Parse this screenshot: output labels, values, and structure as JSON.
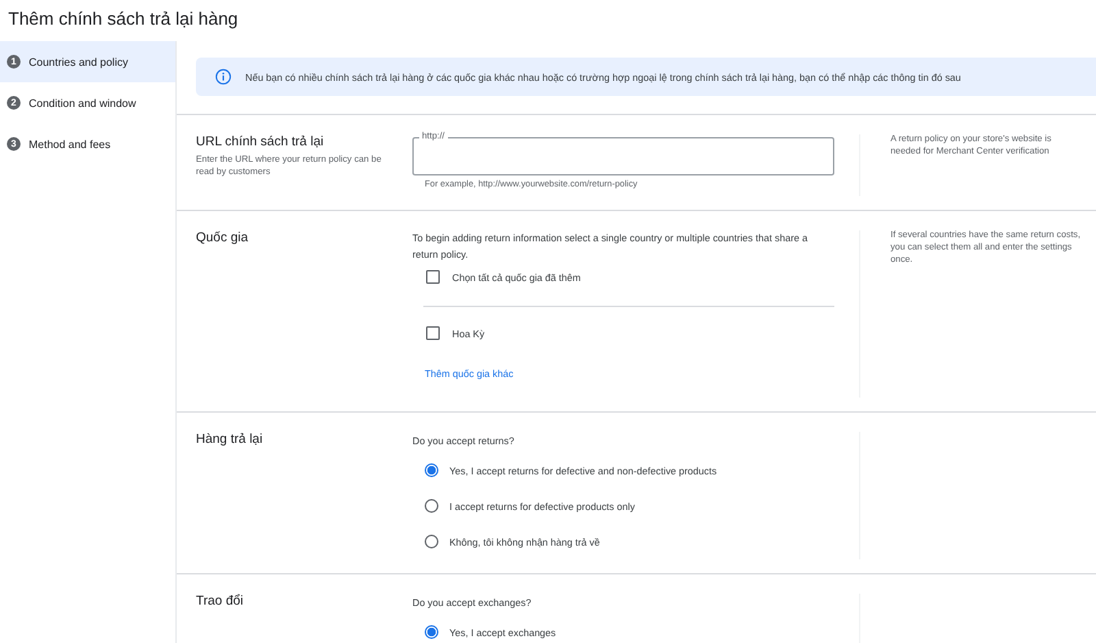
{
  "page_title": "Thêm chính sách trả lại hàng",
  "steps": [
    {
      "number": "1",
      "label": "Countries and policy",
      "selected": true
    },
    {
      "number": "2",
      "label": "Condition and window",
      "selected": false
    },
    {
      "number": "3",
      "label": "Method and fees",
      "selected": false
    }
  ],
  "info_banner": {
    "text": "Nếu bạn có nhiều chính sách trả lại hàng ở các quốc gia khác nhau hoặc có trường hợp ngoại lệ trong chính sách trả lại hàng, bạn có thể nhập các thông tin đó sau"
  },
  "sections": [
    {
      "kind": "url",
      "title": "URL chính sách trả lại",
      "description": "Enter the URL where your return policy can be read by customers",
      "field_label": "http://",
      "helper": "For example, http://www.yourwebsite.com/return-policy",
      "note": "A return policy on your store's website is needed for Merchant Center verification"
    },
    {
      "kind": "countries",
      "title": "Quốc gia",
      "intro": "To begin adding return information select a single country or multiple countries that share a return policy.",
      "select_all": {
        "label": "Chọn tất cả quốc gia đã thêm",
        "checked": false
      },
      "countries": [
        {
          "label": "Hoa Kỳ",
          "checked": false
        }
      ],
      "add_link": "Thêm quốc gia khác",
      "note": "If several countries have the same return costs, you can select them all and enter the settings once."
    },
    {
      "kind": "radio",
      "title": "Hàng trả lại",
      "question": "Do you accept returns?",
      "options": [
        {
          "label": "Yes, I accept returns for defective and non-defective products",
          "selected": true
        },
        {
          "label": "I accept returns for defective products only",
          "selected": false
        },
        {
          "label": "Không, tôi không nhận hàng trả về",
          "selected": false
        }
      ]
    },
    {
      "kind": "radio",
      "title": "Trao đổi",
      "question": "Do you accept exchanges?",
      "options": [
        {
          "label": "Yes, I accept exchanges",
          "selected": true
        }
      ]
    }
  ]
}
